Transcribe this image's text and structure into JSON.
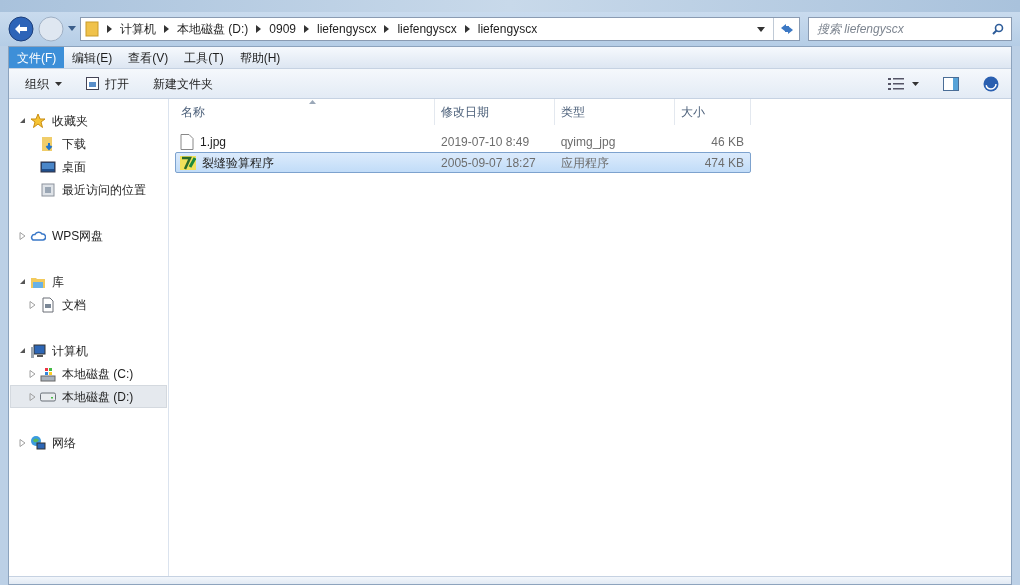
{
  "address_bar": {
    "path": [
      "计算机",
      "本地磁盘 (D:)",
      "0909",
      "liefengyscx",
      "liefengyscx",
      "liefengyscx"
    ]
  },
  "search": {
    "placeholder": "搜索 liefengyscx"
  },
  "menu": [
    {
      "label": "文件(F)",
      "selected": true
    },
    {
      "label": "编辑(E)",
      "selected": false
    },
    {
      "label": "查看(V)",
      "selected": false
    },
    {
      "label": "工具(T)",
      "selected": false
    },
    {
      "label": "帮助(H)",
      "selected": false
    }
  ],
  "toolbar": [
    {
      "kind": "menu",
      "label": "组织"
    },
    {
      "kind": "open",
      "label": "打开"
    },
    {
      "kind": "plain",
      "label": "新建文件夹"
    }
  ],
  "sidebar": {
    "groups": [
      {
        "label": "收藏夹",
        "kind": "star",
        "expanded": true,
        "selected": false,
        "children": [
          {
            "label": "下载",
            "kind": "download",
            "selected": false
          },
          {
            "label": "桌面",
            "kind": "desktop",
            "selected": false
          },
          {
            "label": "最近访问的位置",
            "kind": "recent",
            "selected": false
          }
        ]
      },
      {
        "label": "WPS网盘",
        "kind": "cloud",
        "expanded": false,
        "selected": false
      },
      {
        "label": "库",
        "kind": "library",
        "expanded": true,
        "selected": false,
        "children": [
          {
            "label": "文档",
            "kind": "document",
            "expanded": false,
            "selected": false
          }
        ]
      },
      {
        "label": "计算机",
        "kind": "computer",
        "expanded": true,
        "selected": false,
        "children": [
          {
            "label": "本地磁盘 (C:)",
            "kind": "sysdrive",
            "expanded": false,
            "selected": false
          },
          {
            "label": "本地磁盘 (D:)",
            "kind": "drive",
            "expanded": false,
            "selected": true
          }
        ]
      },
      {
        "label": "网络",
        "kind": "network",
        "expanded": false,
        "selected": false
      }
    ]
  },
  "table": {
    "columns": [
      "名称",
      "修改日期",
      "类型",
      "大小"
    ],
    "rows": [
      {
        "kind": "file",
        "name": "1.jpg",
        "modified": "2019-07-10 8:49",
        "type": "qyimg_jpg",
        "size": "46 KB",
        "selected": false
      },
      {
        "kind": "app",
        "name": "裂缝验算程序",
        "modified": "2005-09-07 18:27",
        "type": "应用程序",
        "size": "474 KB",
        "selected": true
      }
    ]
  }
}
